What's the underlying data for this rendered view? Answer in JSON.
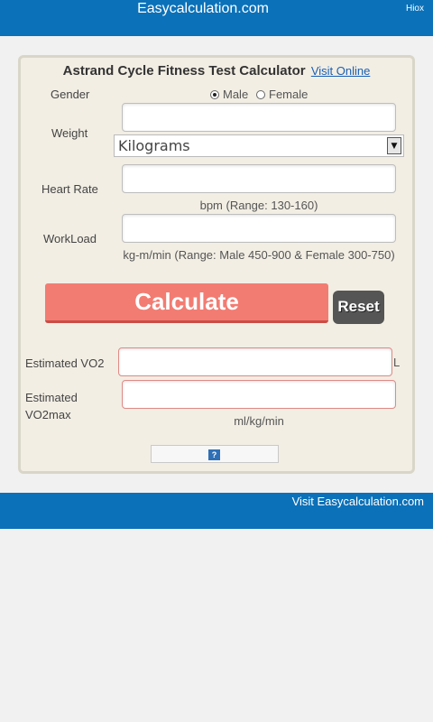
{
  "header": {
    "site": "Easycalculation.com",
    "link": "Hiox"
  },
  "calculator": {
    "title": "Astrand Cycle Fitness Test Calculator",
    "visit_online": "Visit Online",
    "gender": {
      "label": "Gender",
      "options": [
        "Male",
        "Female"
      ],
      "selected": "Male"
    },
    "weight": {
      "label": "Weight",
      "value": "",
      "unit_selected": "Kilograms"
    },
    "heart_rate": {
      "label": "Heart Rate",
      "value": "",
      "hint": "bpm (Range: 130-160)"
    },
    "workload": {
      "label": "WorkLoad",
      "value": "",
      "hint": "kg-m/min (Range: Male 450-900 & Female 300-750)"
    },
    "buttons": {
      "calculate": "Calculate",
      "reset": "Reset"
    },
    "results": {
      "vo2": {
        "label": "Estimated VO2",
        "value": "",
        "unit": "L"
      },
      "vo2max": {
        "label": "Estimated VO2max",
        "value": "",
        "unit": "ml/kg/min"
      }
    },
    "help_icon": "?"
  },
  "footer": {
    "visit": "Visit Easycalculation.com"
  },
  "colors": {
    "bar": "#0b71b9",
    "calculate": "#f27c72",
    "reset": "#555555",
    "panel": "#f2eee4"
  }
}
